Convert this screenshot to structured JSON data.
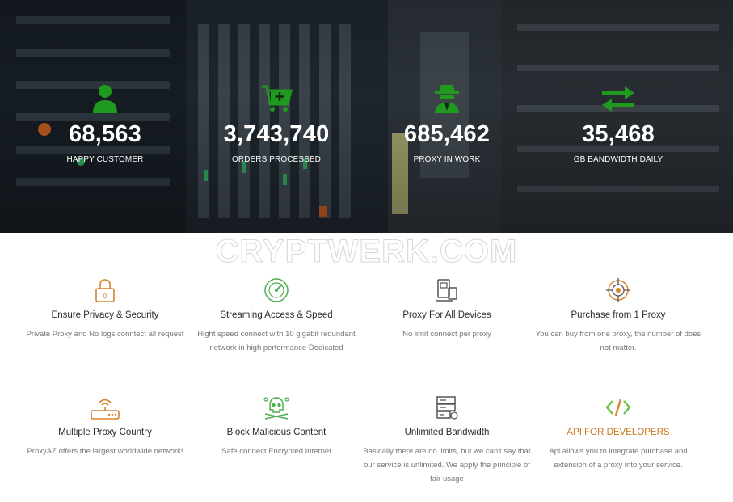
{
  "stats": [
    {
      "icon": "user-icon",
      "value": "68,563",
      "label": "HAPPY CUSTOMER"
    },
    {
      "icon": "cart-icon",
      "value": "3,743,740",
      "label": "ORDERS PROCESSED"
    },
    {
      "icon": "spy-icon",
      "value": "685,462",
      "label": "PROXY IN WORK"
    },
    {
      "icon": "transfer-arrows-icon",
      "value": "35,468",
      "label": "GB BANDWIDTH DAILY"
    }
  ],
  "watermark": "CRYPTWERK.COM",
  "features": [
    {
      "icon": "lock-icon",
      "title": "Ensure Privacy & Security",
      "desc": "Private Proxy and No logs conntect all request"
    },
    {
      "icon": "speed-gauge-icon",
      "title": "Streaming Access & Speed",
      "desc": "Hight speed connect with 10 gigabit redundant network in high performance Dedicated"
    },
    {
      "icon": "devices-icon",
      "title": "Proxy For All Devices",
      "desc": "No limit connect per proxy"
    },
    {
      "icon": "target-icon",
      "title": "Purchase from 1 Proxy",
      "desc": "You can buy from one proxy, the number of does not matter."
    },
    {
      "icon": "router-icon",
      "title": "Multiple Proxy Country",
      "desc": "ProxyAZ offers the largest worldwide network!"
    },
    {
      "icon": "skull-icon",
      "title": "Block Malicious Content",
      "desc": "Safe connect Encrypted Internet"
    },
    {
      "icon": "server-icon",
      "title": "Unlimited Bandwidth",
      "desc": "Basically there are no limits, but we can't say that our service is unlimited. We apply the principle of fair usage"
    },
    {
      "icon": "code-icon",
      "title": "API FOR DEVELOPERS",
      "desc": "Api allows you to integrate purchase and extension of a proxy into your service."
    }
  ],
  "colors": {
    "stat_icon_green": "#1f9a1f",
    "feature_orange": "#d9822b",
    "feature_green": "#4caf50",
    "feature_gray": "#555555",
    "api_title": "#c7781f"
  }
}
